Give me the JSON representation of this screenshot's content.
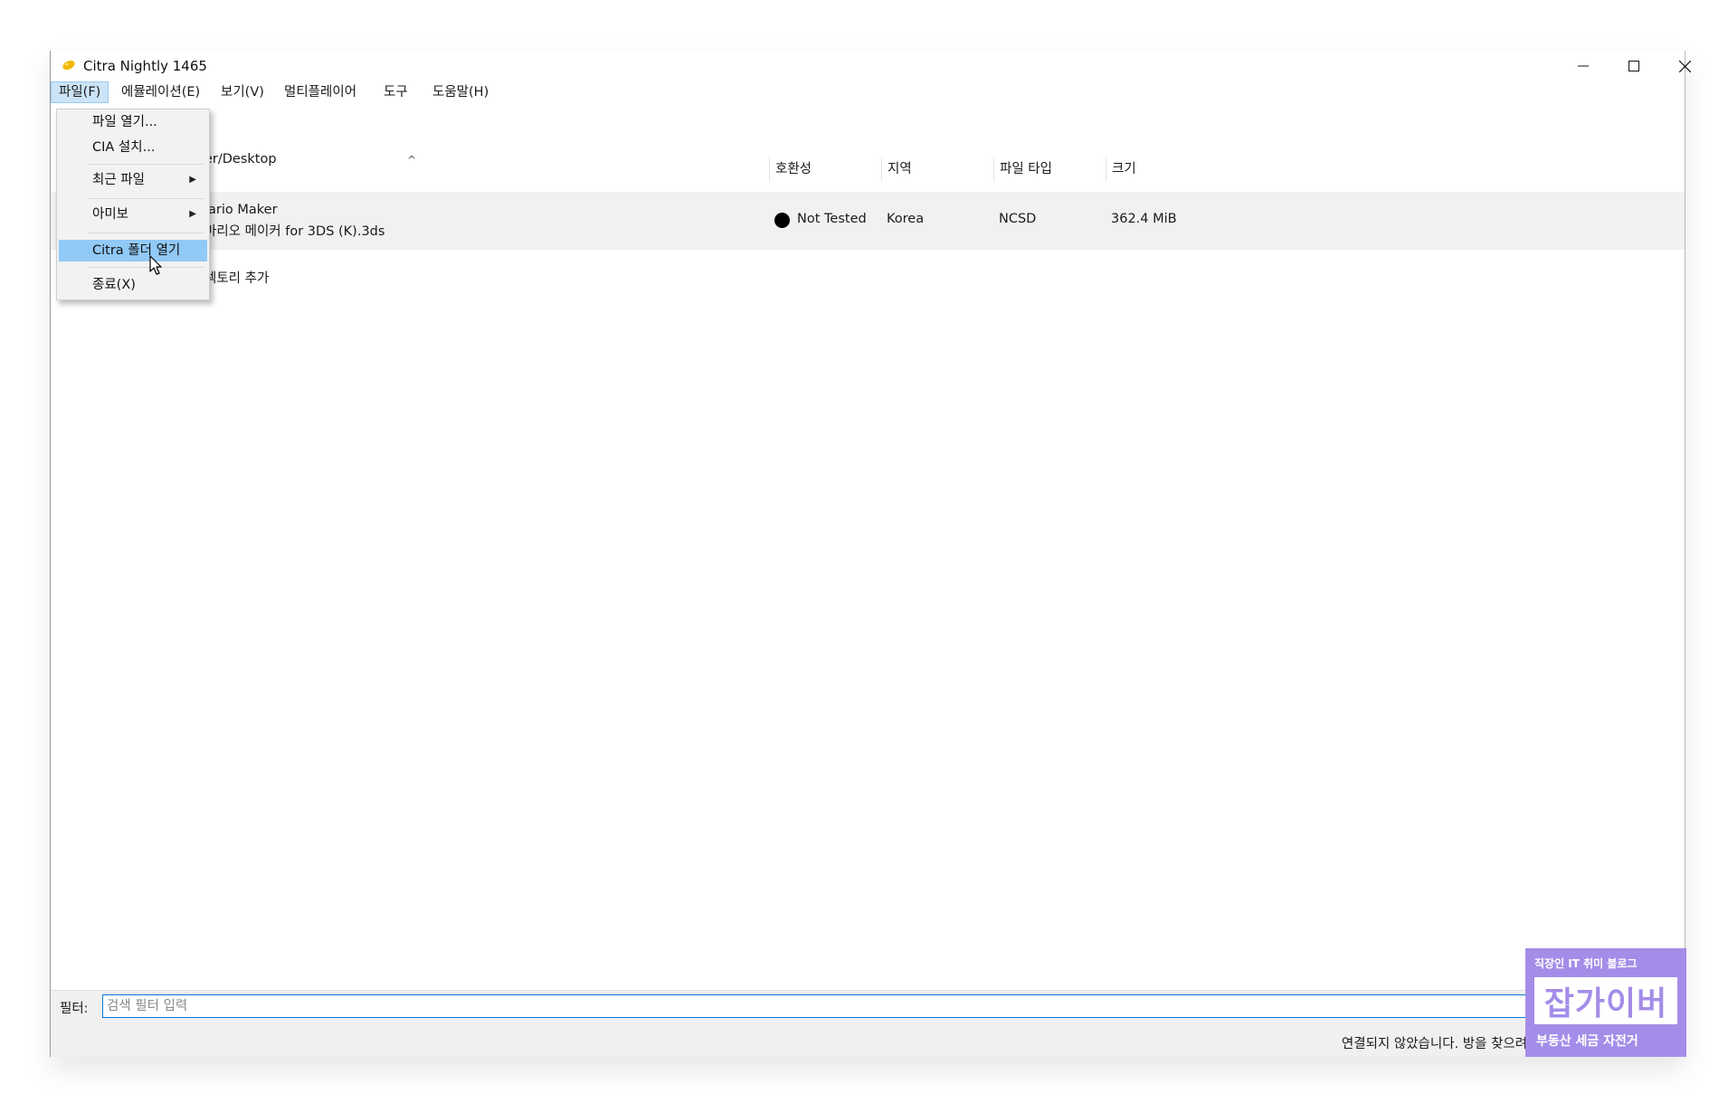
{
  "window": {
    "title": "Citra Nightly 1465",
    "minimize_glyph": "–",
    "maximize_glyph": "□",
    "close_glyph": "×"
  },
  "menubar": {
    "items": [
      "파일(F)",
      "에뮬레이션(E)",
      "보기(V)",
      "멀티플레이어",
      "도구",
      "도움말(H)"
    ]
  },
  "file_menu": {
    "open_file": "파일 열기...",
    "install_cia": "CIA 설치...",
    "recent_files": "최근 파일",
    "amiibo": "아미보",
    "open_citra_folder": "Citra 폴더 열기",
    "exit": "종료(X)"
  },
  "game_list": {
    "sort_indicator": "^",
    "columns": [
      "호환성",
      "지역",
      "파일 타입",
      "크기"
    ],
    "folder_path_partial": "er/Desktop",
    "game_title_line1_partial": "lario Maker",
    "game_title_line2_partial": "마리오 메이커 for 3DS (K).3ds",
    "compatibility": "Not Tested",
    "region": "Korea",
    "file_type": "NCSD",
    "size": "362.4 MiB",
    "add_directory_partial": "렉토리 추가"
  },
  "filter": {
    "label": "필터:",
    "placeholder": "검색 필터 입력",
    "clear_glyph": "×"
  },
  "status_bar": {
    "text": "연결되지 않았습니다. 방을 찾으려면 여기를 클릭하세요."
  },
  "watermark": {
    "top_text": "직장인 IT 취미 블로그",
    "main_text": "잡가이버",
    "bottom_text": "부동산 세금 자전거"
  },
  "colors": {
    "menu_active_bg": "#cce4f7",
    "menu_selected_bg": "#91c9f7",
    "filter_border": "#0a78d7",
    "watermark_purple": "#a48de8"
  },
  "icons": [
    "app-icon",
    "minimize-icon",
    "maximize-icon",
    "close-icon",
    "submenu-arrow-icon",
    "compatibility-dot-icon",
    "mouse-cursor-icon"
  ]
}
